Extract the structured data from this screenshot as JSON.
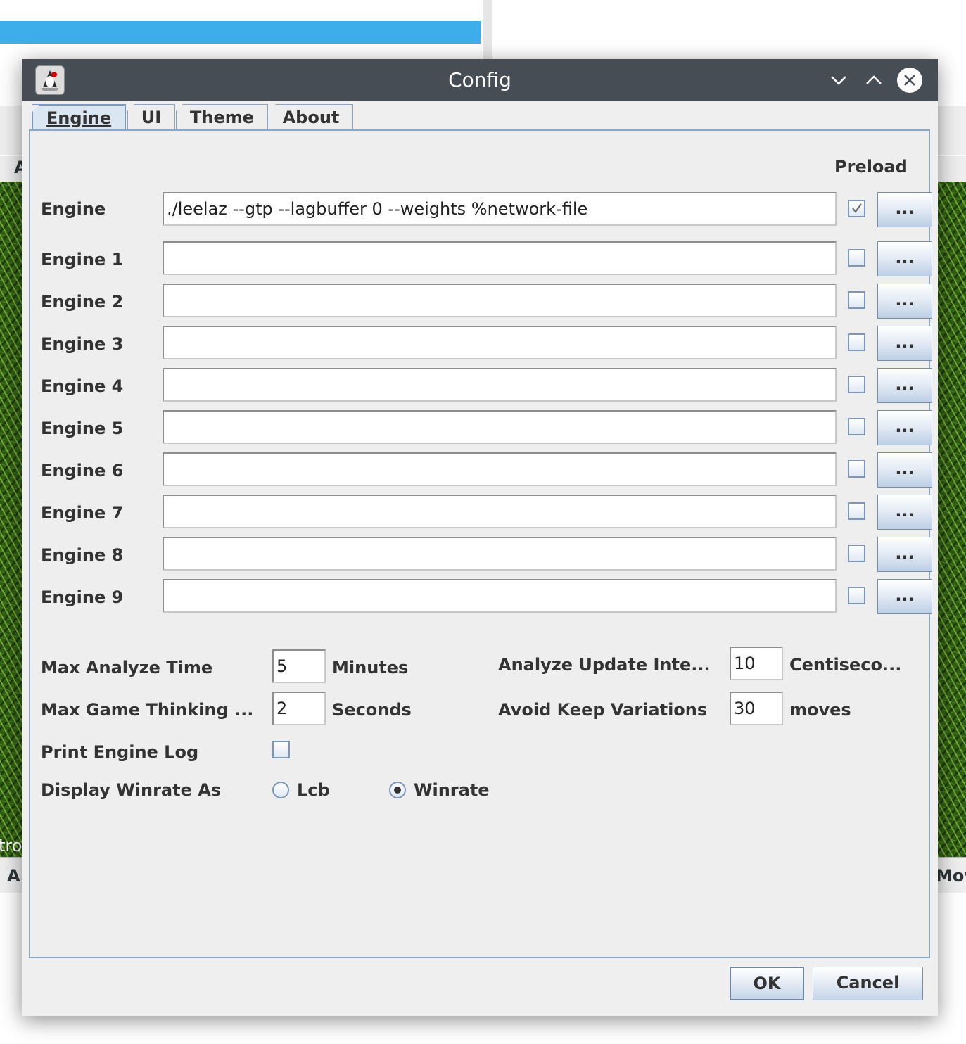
{
  "background": {
    "left_label": "A",
    "left_status_text": "tro",
    "left_status_label": "A",
    "right_status_label": "Mov"
  },
  "dialog": {
    "title": "Config",
    "tabs": [
      "Engine",
      "UI",
      "Theme",
      "About"
    ],
    "active_tab": "Engine"
  },
  "engines": {
    "preload_header": "Preload",
    "browse_label": "...",
    "rows": [
      {
        "label": "Engine",
        "command": "./leelaz --gtp --lagbuffer 0 --weights %network-file",
        "preload": true
      },
      {
        "label": "Engine 1",
        "command": "",
        "preload": false
      },
      {
        "label": "Engine 2",
        "command": "",
        "preload": false
      },
      {
        "label": "Engine 3",
        "command": "",
        "preload": false
      },
      {
        "label": "Engine 4",
        "command": "",
        "preload": false
      },
      {
        "label": "Engine 5",
        "command": "",
        "preload": false
      },
      {
        "label": "Engine 6",
        "command": "",
        "preload": false
      },
      {
        "label": "Engine 7",
        "command": "",
        "preload": false
      },
      {
        "label": "Engine 8",
        "command": "",
        "preload": false
      },
      {
        "label": "Engine 9",
        "command": "",
        "preload": false
      }
    ]
  },
  "settings": {
    "max_analyze_time": {
      "label": "Max Analyze Time",
      "value": "5",
      "unit": "Minutes"
    },
    "max_game_thinking": {
      "label": "Max Game Thinking ...",
      "value": "2",
      "unit": "Seconds"
    },
    "analyze_update_interval": {
      "label": "Analyze Update Inte...",
      "value": "10",
      "unit": "Centiseco..."
    },
    "avoid_keep_variations": {
      "label": "Avoid Keep Variations",
      "value": "30",
      "unit": "moves"
    },
    "print_engine_log": {
      "label": "Print Engine Log",
      "checked": false
    },
    "display_winrate_as": {
      "label": "Display Winrate As",
      "options": [
        "Lcb",
        "Winrate"
      ],
      "selected": "Winrate"
    }
  },
  "footer": {
    "ok_label": "OK",
    "cancel_label": "Cancel"
  },
  "colors": {
    "titlebar": "#474d54",
    "selection_blue": "#3daee9",
    "tab_active": "#dbe6f3",
    "border_blue": "#8ea5be"
  }
}
